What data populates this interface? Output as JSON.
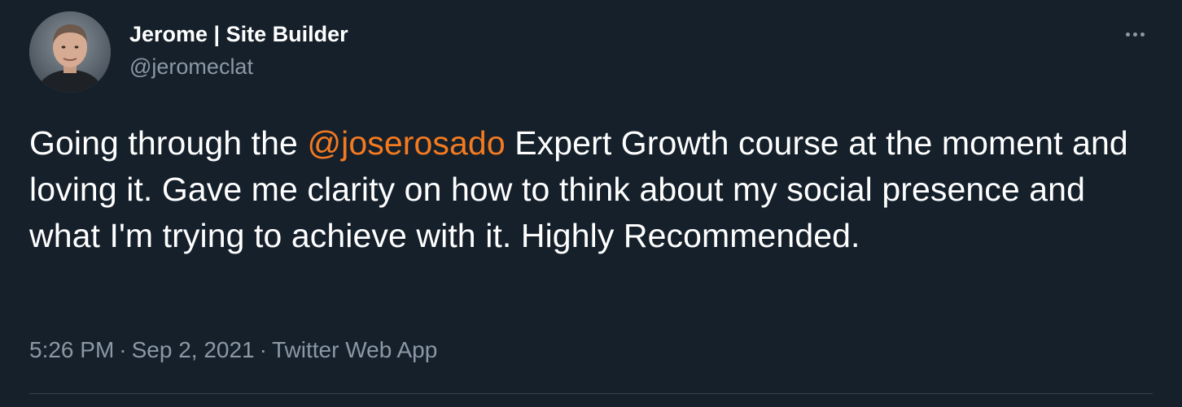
{
  "author": {
    "display_name": "Jerome | Site Builder",
    "handle": "@jeromeclat",
    "avatar_icon": "profile-photo"
  },
  "more_icon": "ellipsis-icon",
  "tweet": {
    "text_before": "Going through the ",
    "mention": "@joserosado",
    "text_after": " Expert Growth course at the moment and loving it. Gave me clarity on how to think about my social presence and what I'm trying to achieve with it. Highly Recommended."
  },
  "meta": {
    "time": "5:26 PM",
    "date": "Sep 2, 2021",
    "source": "Twitter Web App",
    "separator": "·"
  },
  "colors": {
    "background": "#15202b",
    "text": "#ffffff",
    "secondary": "#8b98a5",
    "accent": "#f47a20",
    "divider": "#38444d"
  }
}
